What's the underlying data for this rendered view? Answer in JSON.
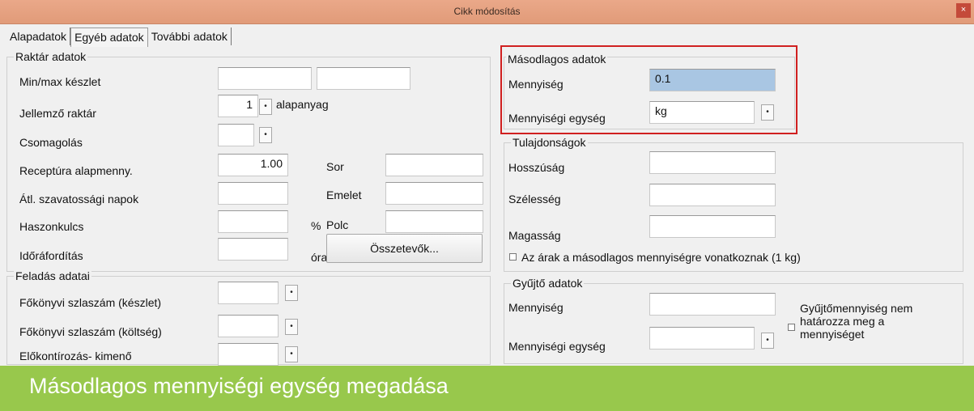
{
  "window": {
    "title": "Cikk módosítás",
    "close": "×"
  },
  "tabs": [
    "Alapadatok",
    "Egyéb adatok",
    "További adatok"
  ],
  "raktar": {
    "group_label": "Raktár adatok",
    "minmax_label": "Min/max készlet",
    "jellemzo_label": "Jellemző raktár",
    "jellemzo_value": "1",
    "jellemzo_name": "alapanyag",
    "csomagolas_label": "Csomagolás",
    "receptura_label": "Receptúra alapmenny.",
    "receptura_value": "1.00",
    "atl_label": "Átl. szavatossági napok",
    "haszon_label": "Haszonkulcs",
    "haszon_unit": "%",
    "ido_label": "Időráfordítás",
    "ido_unit": "óra",
    "sor_label": "Sor",
    "emelet_label": "Emelet",
    "polc_label": "Polc",
    "osszetevok_button": "Összetevők..."
  },
  "feladas": {
    "group_label": "Feladás adatai",
    "fokonyvi_keszlet_label": "Főkönyvi szlaszám (készlet)",
    "fokonyvi_koltseg_label": "Főkönyvi szlaszám (költség)",
    "elokontirozas_label": "Előkontírozás- kimenő"
  },
  "masodlagos": {
    "group_label": "Másodlagos adatok",
    "mennyiseg_label": "Mennyiség",
    "mennyiseg_value": "0.1",
    "egyseg_label": "Mennyiségi egység",
    "egyseg_value": "kg"
  },
  "tulajdonsagok": {
    "group_label": "Tulajdonságok",
    "hossz_label": "Hosszúság",
    "szel_label": "Szélesség",
    "mag_label": "Magasság",
    "arak_checkbox": "Az árak a másodlagos mennyiségre vonatkoznak (1 kg)"
  },
  "gyujto": {
    "group_label": "Gyűjtő adatok",
    "mennyiseg_label": "Mennyiség",
    "egyseg_label": "Mennyiségi egység",
    "checkbox_line1": "Gyűjtőmennyiség nem",
    "checkbox_line2": "határozza meg a",
    "checkbox_line3": "mennyiséget"
  },
  "dropdown_glyph": "•",
  "banner": {
    "text": "Másodlagos mennyiségi egység megadása"
  },
  "colors": {
    "highlight": "#d02020",
    "banner": "#98c84c",
    "titlebar": "#e19b79"
  }
}
